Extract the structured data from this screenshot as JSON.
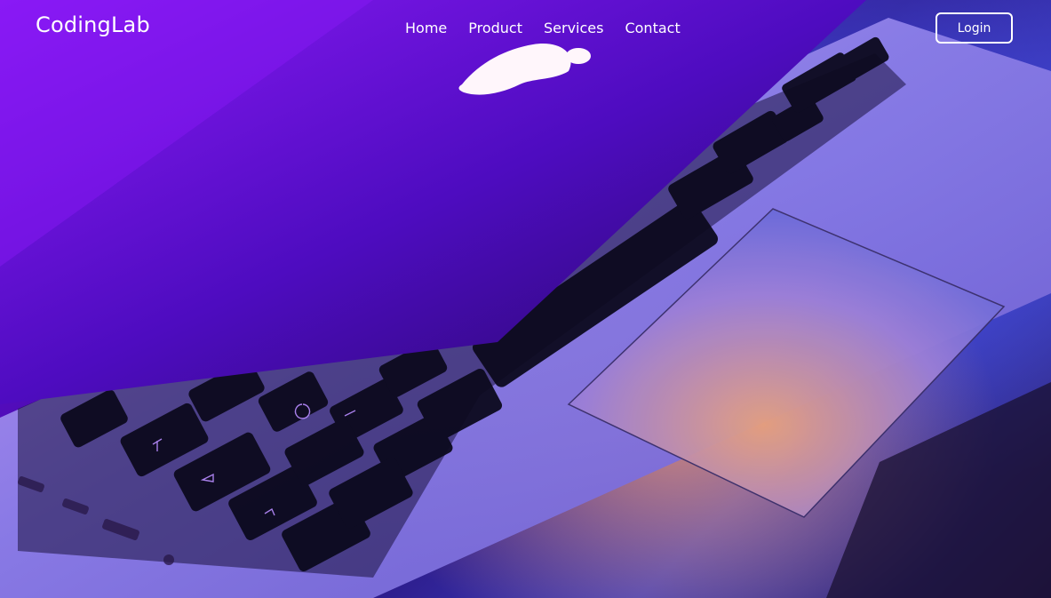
{
  "brand": {
    "name": "CodingLab"
  },
  "nav": {
    "items": [
      {
        "label": "Home"
      },
      {
        "label": "Product"
      },
      {
        "label": "Services"
      },
      {
        "label": "Contact"
      }
    ]
  },
  "header": {
    "login_label": "Login"
  },
  "hero": {
    "background_icon": "laptop-photo",
    "colors": {
      "purple": "#7a10f0",
      "blue": "#3b3dbf",
      "peach": "#e6967a"
    }
  }
}
